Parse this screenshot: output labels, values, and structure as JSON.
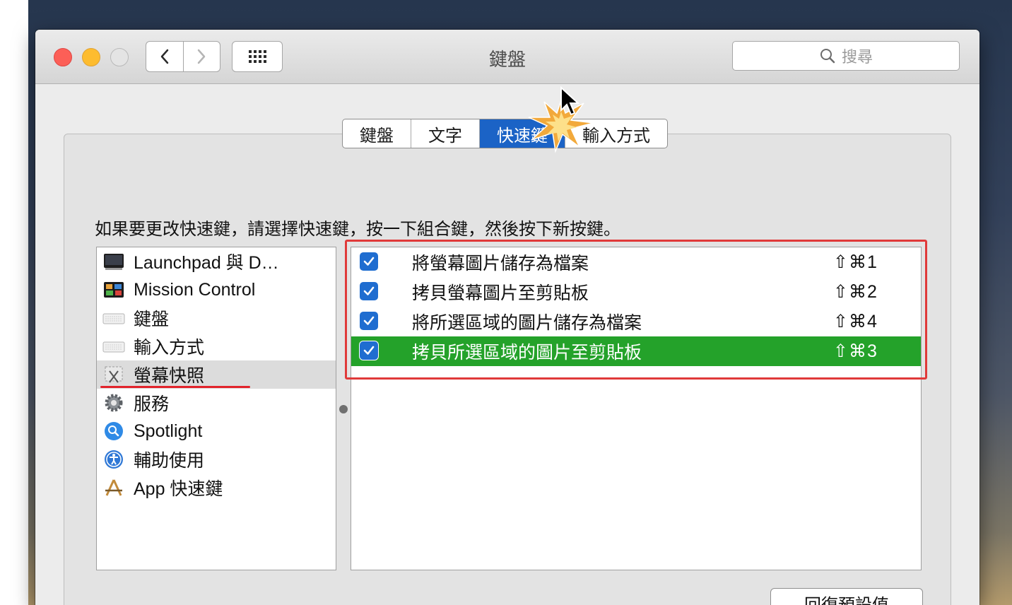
{
  "window": {
    "title": "鍵盤"
  },
  "search": {
    "placeholder": "搜尋"
  },
  "tabs": [
    {
      "label": "鍵盤",
      "active": false
    },
    {
      "label": "文字",
      "active": false
    },
    {
      "label": "快速鍵",
      "active": true
    },
    {
      "label": "輸入方式",
      "active": false
    }
  ],
  "instruction": "如果要更改快速鍵，請選擇快速鍵，按一下組合鍵，然後按下新按鍵。",
  "categories": [
    {
      "label": "Launchpad 與 D…",
      "icon": "launchpad-icon"
    },
    {
      "label": "Mission Control",
      "icon": "mission-control-icon"
    },
    {
      "label": "鍵盤",
      "icon": "keyboard-icon"
    },
    {
      "label": "輸入方式",
      "icon": "keyboard-icon"
    },
    {
      "label": "螢幕快照",
      "icon": "screenshot-icon",
      "selected": true
    },
    {
      "label": "服務",
      "icon": "gear-icon"
    },
    {
      "label": "Spotlight",
      "icon": "spotlight-icon"
    },
    {
      "label": "輔助使用",
      "icon": "accessibility-icon"
    },
    {
      "label": "App 快速鍵",
      "icon": "app-shortcuts-icon"
    }
  ],
  "shortcuts": [
    {
      "label": "將螢幕圖片儲存為檔案",
      "key": "⇧⌘1",
      "checked": true
    },
    {
      "label": "拷貝螢幕圖片至剪貼板",
      "key": "⇧⌘2",
      "checked": true
    },
    {
      "label": "將所選區域的圖片儲存為檔案",
      "key": "⇧⌘4",
      "checked": true
    },
    {
      "label": "拷貝所選區域的圖片至剪貼板",
      "key": "⇧⌘3",
      "checked": true,
      "selected": true
    }
  ],
  "restore_button": "回復預設值",
  "colors": {
    "selected_tab": "#1b63c6",
    "selected_row": "#24a22a",
    "checkbox": "#1f6dd0",
    "annotation_red": "#e03a3a"
  }
}
